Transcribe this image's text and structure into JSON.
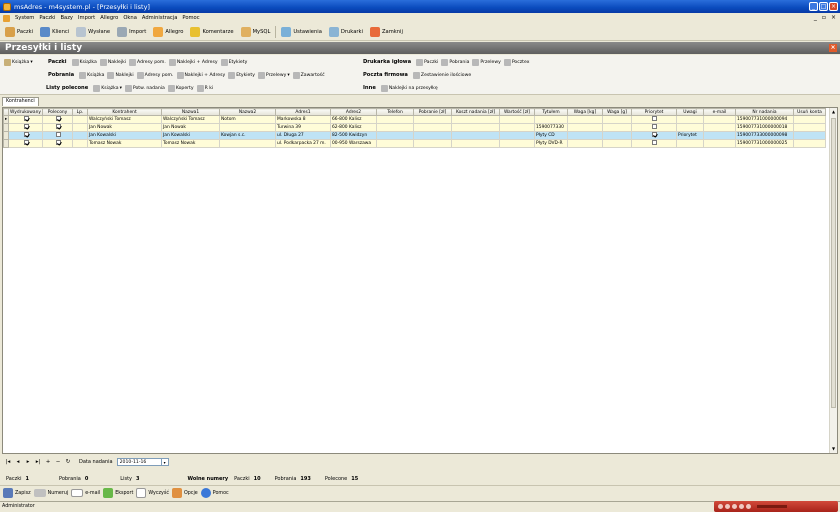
{
  "window": {
    "title": "msAdres - m4system.pl - [Przesyłki i listy]"
  },
  "menu": [
    "System",
    "Paczki",
    "Bazy",
    "Import",
    "Allegro",
    "Okna",
    "Administracja",
    "Pomoc"
  ],
  "toolbar": [
    "Paczki",
    "Klienci",
    "Wysłane",
    "Import",
    "Allegro",
    "Komentarze",
    "MySQL",
    "Ustawienia",
    "Drukarki",
    "Zamknij"
  ],
  "header": {
    "title": "Przesyłki i listy"
  },
  "ribbon": {
    "book": "Książka",
    "paczki": {
      "label": "Paczki",
      "items": [
        "Książka",
        "Naklejki",
        "Adresy pom.",
        "Naklejki + Adresy",
        "Etykiety"
      ]
    },
    "pobrania": {
      "label": "Pobrania",
      "items": [
        "Książka",
        "Naklejki",
        "Adresy pom.",
        "Naklejki + Adresy",
        "Etykiety",
        "Przelewy",
        "Zawartość"
      ]
    },
    "polecone": {
      "label": "Listy polecone",
      "items": [
        "Książka",
        "Potw. nadania",
        "Koperty",
        "R ki"
      ]
    },
    "drukarka": {
      "label": "Drukarka igłowa",
      "items": [
        "Paczki",
        "Pobrania",
        "Przelewy",
        "Pocztex"
      ]
    },
    "poczta": {
      "label": "Poczta firmowa",
      "items": [
        "Zestawienie ilościowe"
      ]
    },
    "inne": {
      "label": "Inne",
      "items": [
        "Naklejki na przesyłkę"
      ]
    }
  },
  "tab": "Kontrahenci",
  "table": {
    "columns": [
      "Wydrukowany",
      "Polecony",
      "Lp.",
      "Kontrahent",
      "Nazwa1",
      "Nazwa2",
      "Adres1",
      "Adres2",
      "Telefon",
      "Pobranie [zł]",
      "Koszt nadania [zł]",
      "Wartość [zł]",
      "Tytułem",
      "Waga [kg]",
      "Waga [g]",
      "Priorytet",
      "Uwagi",
      "e-mail",
      "Nr nadania",
      "Usuń konta"
    ],
    "rows": [
      {
        "wydrukowany": true,
        "polecony": true,
        "priorytet": false,
        "cells": [
          "",
          "",
          "",
          "Walczyński Tomasz",
          "Walczyński Tomasz",
          "Notom",
          "Markowska 8",
          "66-800 Kalisz",
          "",
          "",
          "",
          "",
          "",
          "",
          "",
          "",
          "",
          "",
          "159007731000000094",
          ""
        ]
      },
      {
        "wydrukowany": true,
        "polecony": true,
        "priorytet": false,
        "cells": [
          "",
          "",
          "",
          "Jan Nowak",
          "Jan Nowak",
          "",
          "Turwina 39",
          "62-800 Kalisz",
          "",
          "",
          "",
          "",
          "1590077330",
          "",
          "",
          "",
          "",
          "",
          "159007731000000018",
          ""
        ]
      },
      {
        "wydrukowany": true,
        "polecony": false,
        "priorytet": true,
        "cells": [
          "",
          "",
          "",
          "Jan Kowalski",
          "Jan Kowalski",
          "Kowjan s.c.",
          "ul. Długa 27",
          "82-500 Kwidzyn",
          "",
          "",
          "",
          "",
          "Płyty CD",
          "",
          "",
          "",
          "Priorytet",
          "",
          "159007733000000098",
          ""
        ]
      },
      {
        "wydrukowany": true,
        "polecony": true,
        "priorytet": false,
        "cells": [
          "",
          "",
          "",
          "Tomasz Nowak",
          "Tomasz Nowak",
          "",
          "ul. Podkarpacka 27 m.",
          "00-950 Warszawa",
          "",
          "",
          "",
          "",
          "Płyty DVD-R",
          "",
          "",
          "",
          "",
          "",
          "159007731000000025",
          ""
        ]
      }
    ]
  },
  "navbar": {
    "date_label": "Data nadania",
    "date_value": "2010-11-16"
  },
  "status": {
    "paczki_label": "Paczki",
    "paczki_value": "1",
    "pobrania_label": "Pobrania",
    "pobrania_value": "0",
    "listy_label": "Listy",
    "listy_value": "3",
    "wolne_label": "Wolne numery",
    "wolne_paczki_label": "Paczki",
    "wolne_paczki_value": "10",
    "wolne_pobrania_label": "Pobrania",
    "wolne_pobrania_value": "193",
    "wolne_polecone_label": "Polecone",
    "wolne_polecone_value": "15"
  },
  "bottom": [
    "Zapisz",
    "Numeruj",
    "e-mail",
    "Eksport",
    "Wyczyść",
    "Opcje",
    "Pomoc"
  ],
  "statusbar": {
    "user": "Administrator"
  }
}
